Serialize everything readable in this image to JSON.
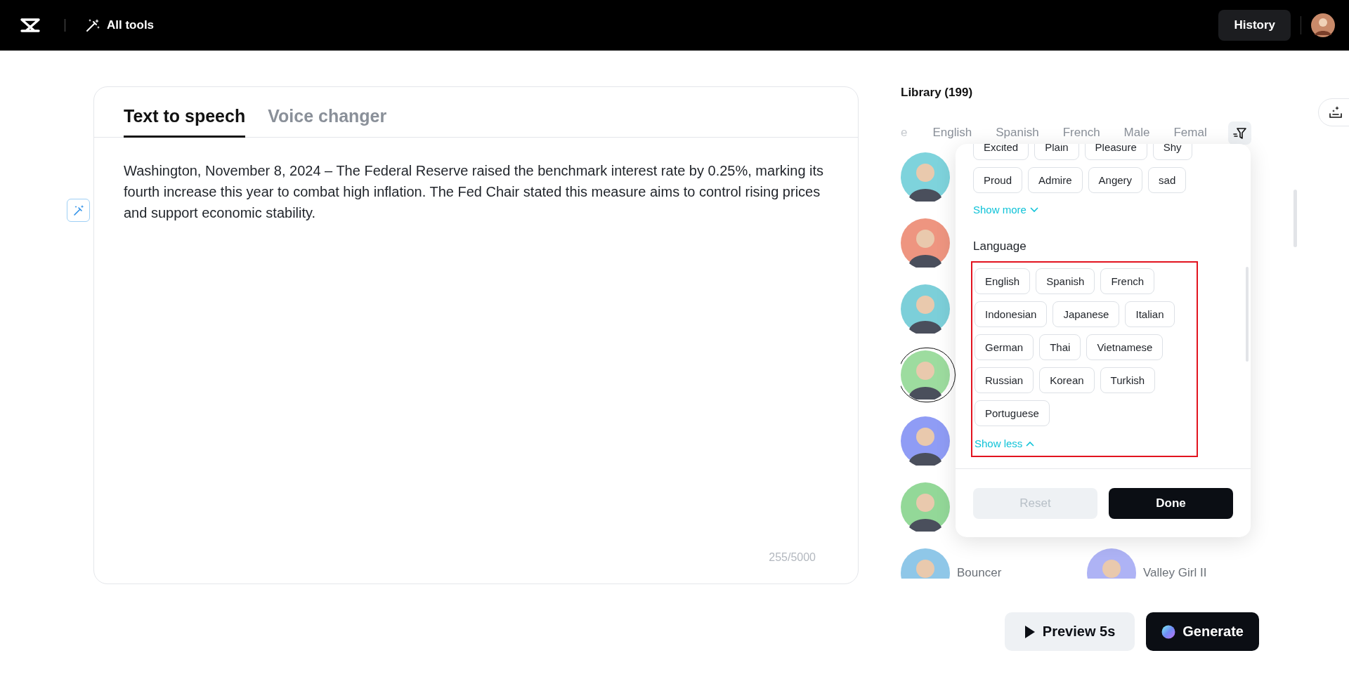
{
  "topbar": {
    "menu_label": "All tools",
    "history_button": "History"
  },
  "editor": {
    "tabs": [
      {
        "label": "Text to speech",
        "selected": true
      },
      {
        "label": "Voice changer",
        "selected": false
      }
    ],
    "text": "Washington, November 8, 2024 – The Federal Reserve raised the benchmark interest rate by 0.25%, marking its fourth increase this year to combat high inflation. The Fed Chair stated this measure aims to control rising prices and support economic stability.",
    "counter": "255/5000"
  },
  "library": {
    "title": "Library (199)",
    "filters": [
      "e",
      "English",
      "Spanish",
      "French",
      "Male",
      "Femal"
    ],
    "voices": [
      {
        "color": "#7ed3dc",
        "selected": false
      },
      {
        "color": "#ee9580",
        "selected": false
      },
      {
        "color": "#7ccfd9",
        "selected": false
      },
      {
        "color": "#9ddc9f",
        "selected": true
      },
      {
        "color": "#8f9cf5",
        "selected": false
      },
      {
        "color": "#93d898",
        "selected": false
      },
      {
        "name": "Bouncer",
        "color": "#8fc7e8",
        "selected": false
      },
      {
        "name": "Valley Girl II",
        "color": "#aeb3f5",
        "selected": false
      }
    ]
  },
  "filter_popup": {
    "emotions": [
      "Excited",
      "Plain",
      "Pleasure",
      "Shy",
      "Proud",
      "Admire",
      "Angery",
      "sad"
    ],
    "show_more": "Show more",
    "language_title": "Language",
    "language_highlighted": true,
    "languages": [
      "English",
      "Spanish",
      "French",
      "Indonesian",
      "Japanese",
      "Italian",
      "German",
      "Thai",
      "Vietnamese",
      "Russian",
      "Korean",
      "Turkish",
      "Portuguese"
    ],
    "show_less": "Show less",
    "reset": {
      "label": "Reset",
      "disabled": true
    },
    "done": "Done"
  },
  "actions": {
    "preview": "Preview 5s",
    "generate": "Generate"
  }
}
